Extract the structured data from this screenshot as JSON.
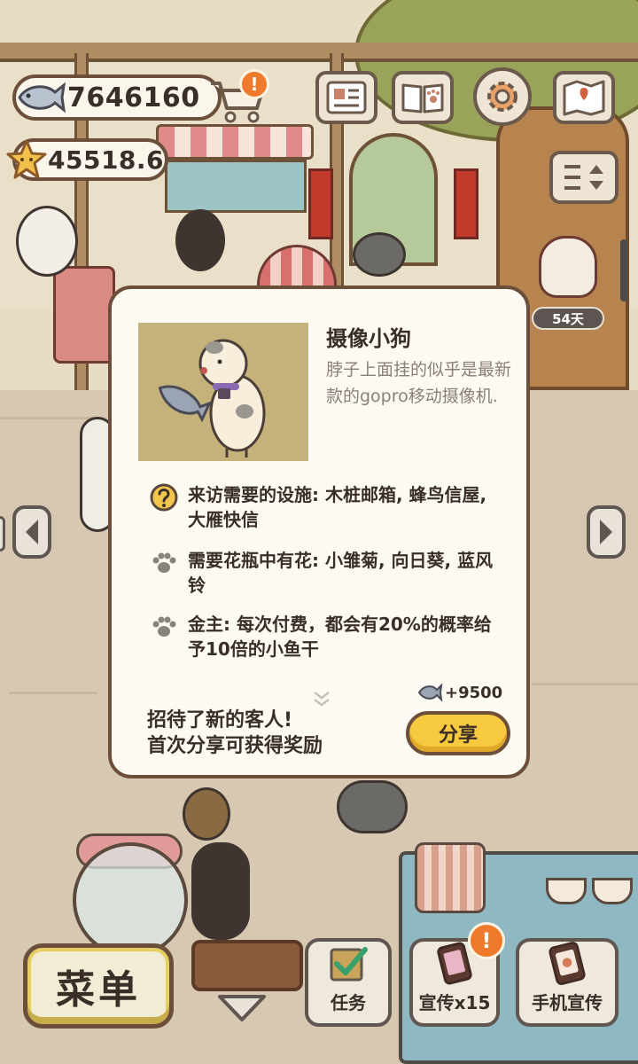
{
  "hud": {
    "fish_coins": "7646160",
    "stars": "45518.6",
    "shop_alert": "!",
    "days_badge": "54天"
  },
  "icons": {
    "fish": "fish-icon",
    "star": "star-icon",
    "cart": "cart-icon",
    "newspaper": "newspaper-icon",
    "paw_book": "paw-book-icon",
    "settings": "gear-icon",
    "map": "map-icon",
    "toggle": "toggle-icon"
  },
  "modal": {
    "title": "摄像小狗",
    "description": "脖子上面挂的似乎是最新款的gopro移动摄像机.",
    "requirements": [
      {
        "icon": "question-icon",
        "text": "来访需要的设施: 木桩邮箱, 蜂鸟信屋, 大雁快信"
      },
      {
        "icon": "paw-icon",
        "text": "需要花瓶中有花: 小雏菊, 向日葵, 蓝风铃"
      },
      {
        "icon": "paw-icon",
        "text": "金主: 每次付费，都会有20%的概率给予10倍的小鱼干"
      }
    ],
    "reward": "+9500",
    "share_message_line1": "招待了新的客人!",
    "share_message_line2": "首次分享可获得奖励",
    "share_button": "分享"
  },
  "bottom_bar": {
    "menu": "菜单",
    "tasks": "任务",
    "promote": "宣传x15",
    "promote_alert": "!",
    "phone_promote": "手机宣传"
  },
  "colors": {
    "border_brown": "#6b4f3a",
    "share_yellow": "#f7c93e",
    "alert_orange": "#f07a2c",
    "modal_bg": "#fdfaf3",
    "portrait_bg": "#c5b27a"
  }
}
